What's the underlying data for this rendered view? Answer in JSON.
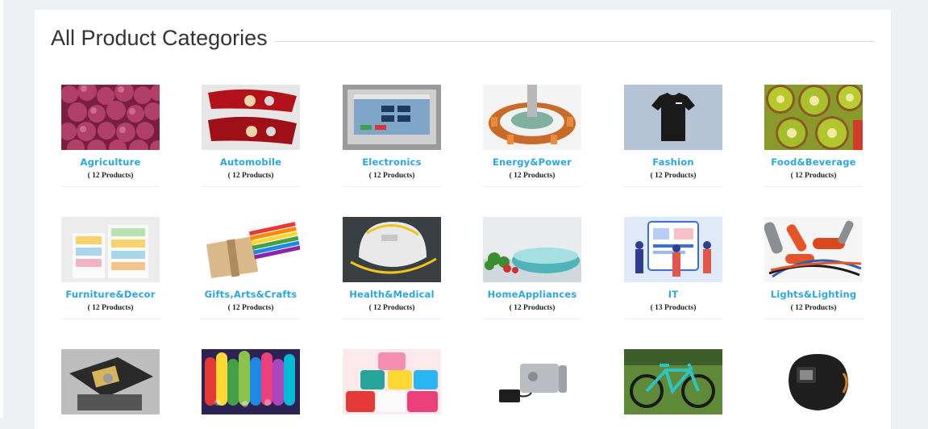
{
  "page": {
    "title": "All Product Categories"
  },
  "categories": [
    {
      "name": "Agriculture",
      "count": "( 12 Products)",
      "icon": "onions-photo"
    },
    {
      "name": "Automobile",
      "count": "( 12 Products)",
      "icon": "tail-lights-photo"
    },
    {
      "name": "Electronics",
      "count": "( 12 Products)",
      "icon": "hmi-panel-photo"
    },
    {
      "name": "Energy&Power",
      "count": "( 12 Products)",
      "icon": "stator-coil-photo"
    },
    {
      "name": "Fashion",
      "count": "( 12 Products)",
      "icon": "black-tshirt-photo"
    },
    {
      "name": "Food&Beverage",
      "count": "( 12 Products)",
      "icon": "kiwi-slices-photo"
    },
    {
      "name": "Furniture&Decor",
      "count": "( 12 Products)",
      "icon": "pastel-drawers-photo"
    },
    {
      "name": "Gifts,Arts&Crafts",
      "count": "( 12 Products)",
      "icon": "craft-sticks-photo"
    },
    {
      "name": "Health&Medical",
      "count": "( 12 Products)",
      "icon": "n95-mask-photo"
    },
    {
      "name": "HomeAppliances",
      "count": "( 12 Products)",
      "icon": "salad-spinner-photo"
    },
    {
      "name": "IT",
      "count": "( 13 Products)",
      "icon": "people-screen-illustration"
    },
    {
      "name": "Lights&Lighting",
      "count": "( 12 Products)",
      "icon": "rubber-tubes-photo"
    },
    {
      "name": "",
      "count": "",
      "icon": "print-head-photo"
    },
    {
      "name": "",
      "count": "",
      "icon": "foam-tubes-photo"
    },
    {
      "name": "",
      "count": "",
      "icon": "yarn-cones-photo"
    },
    {
      "name": "",
      "count": "",
      "icon": "electric-lock-photo"
    },
    {
      "name": "",
      "count": "",
      "icon": "mountain-bike-photo"
    },
    {
      "name": "",
      "count": "",
      "icon": "welding-helmet-photo"
    }
  ],
  "colors": {
    "link": "#2aa7dc",
    "background": "#eef0f4",
    "card": "#ffffff"
  }
}
